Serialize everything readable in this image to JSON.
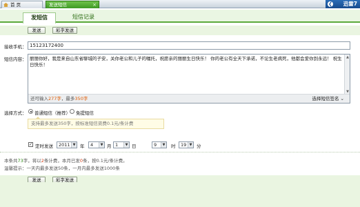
{
  "window_tabs": {
    "home_label": "首 页",
    "sms_label": "发送短信",
    "close_glyph": "×"
  },
  "brand": {
    "name": "迅雷7",
    "icon": "back-arrow-icon"
  },
  "subtabs": {
    "send_label": "发短信",
    "records_label": "短信记录"
  },
  "toolbar": {
    "send_label": "发送",
    "save_label": "彩字发送"
  },
  "form": {
    "phone_label": "接收手机：",
    "phone_value": "15123172400",
    "content_label": "短信内容：",
    "content_value": "丽丽你好，我是来自山东省聊城的子安，关你老公和儿子的嘱托，祝愿亲的丽丽生日快乐！ 你的老公有全天下承诺，不论生老病死，他都会爱你到永远！ 祝生日快乐！",
    "counter_prefix": "还可输入",
    "counter_remaining": "277字",
    "counter_middle": "，最多",
    "counter_max": "350字",
    "signature_label": "选择短信签名",
    "method_label": "选择方式：",
    "method_option_normal": "普通短信（推荐）",
    "method_option_free": "免提短信",
    "method_tip": "支持最多发送350字，按标准短信资费0.1元/条计费",
    "timed_label": "定时发送",
    "year_value": "2011",
    "year_unit": "年",
    "month_value": "4",
    "month_unit": "月",
    "day_value": "1",
    "day_unit": "日",
    "hour_value": "9",
    "hour_unit": "时",
    "minute_value": "19",
    "minute_unit": "分"
  },
  "stats": {
    "line1_prefix": "本条共",
    "line1_chars": "73",
    "line1_mid1": "字，将以",
    "line1_parts": "2",
    "line1_mid2": "条计费，本月已发",
    "line1_sent": "0",
    "line1_suffix": "条，按0.1元/条计费。",
    "line2": "温馨提示：一天内最多发送50条，一月内最多发送1000条"
  },
  "colors": {
    "accent_green": "#5aa93a",
    "highlight_orange": "#e05a00",
    "brand_blue": "#1a56a0"
  }
}
